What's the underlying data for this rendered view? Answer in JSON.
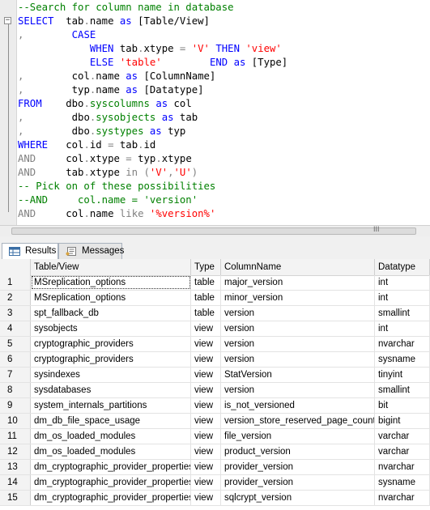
{
  "editor": {
    "lines": [
      [
        {
          "t": "--Search for column name in database",
          "c": "cm"
        }
      ],
      [
        {
          "t": "SELECT",
          "c": "kw"
        },
        {
          "t": "  tab",
          "c": "tx"
        },
        {
          "t": ".",
          "c": "gr"
        },
        {
          "t": "name ",
          "c": "tx"
        },
        {
          "t": "as",
          "c": "kw"
        },
        {
          "t": " [Table/View]",
          "c": "tx"
        }
      ],
      [
        {
          "t": ",",
          "c": "gr"
        },
        {
          "t": "        ",
          "c": "tx"
        },
        {
          "t": "CASE",
          "c": "kw"
        }
      ],
      [
        {
          "t": "            ",
          "c": "tx"
        },
        {
          "t": "WHEN",
          "c": "kw"
        },
        {
          "t": " tab",
          "c": "tx"
        },
        {
          "t": ".",
          "c": "gr"
        },
        {
          "t": "xtype ",
          "c": "tx"
        },
        {
          "t": "=",
          "c": "gr"
        },
        {
          "t": " ",
          "c": "tx"
        },
        {
          "t": "'V'",
          "c": "st"
        },
        {
          "t": " ",
          "c": "tx"
        },
        {
          "t": "THEN",
          "c": "kw"
        },
        {
          "t": " ",
          "c": "tx"
        },
        {
          "t": "'view'",
          "c": "st"
        }
      ],
      [
        {
          "t": "            ",
          "c": "tx"
        },
        {
          "t": "ELSE",
          "c": "kw"
        },
        {
          "t": " ",
          "c": "tx"
        },
        {
          "t": "'table'",
          "c": "st"
        },
        {
          "t": "        ",
          "c": "tx"
        },
        {
          "t": "END",
          "c": "kw"
        },
        {
          "t": " ",
          "c": "tx"
        },
        {
          "t": "as",
          "c": "kw"
        },
        {
          "t": " [Type]",
          "c": "tx"
        }
      ],
      [
        {
          "t": ",",
          "c": "gr"
        },
        {
          "t": "        col",
          "c": "tx"
        },
        {
          "t": ".",
          "c": "gr"
        },
        {
          "t": "name ",
          "c": "tx"
        },
        {
          "t": "as",
          "c": "kw"
        },
        {
          "t": " [ColumnName]",
          "c": "tx"
        }
      ],
      [
        {
          "t": ",",
          "c": "gr"
        },
        {
          "t": "        typ",
          "c": "tx"
        },
        {
          "t": ".",
          "c": "gr"
        },
        {
          "t": "name ",
          "c": "tx"
        },
        {
          "t": "as",
          "c": "kw"
        },
        {
          "t": " [Datatype]",
          "c": "tx"
        }
      ],
      [
        {
          "t": "FROM",
          "c": "kw"
        },
        {
          "t": "    dbo",
          "c": "tx"
        },
        {
          "t": ".",
          "c": "gr"
        },
        {
          "t": "syscolumns",
          "c": "sy"
        },
        {
          "t": " ",
          "c": "tx"
        },
        {
          "t": "as",
          "c": "kw"
        },
        {
          "t": " col",
          "c": "tx"
        }
      ],
      [
        {
          "t": ",",
          "c": "gr"
        },
        {
          "t": "        dbo",
          "c": "tx"
        },
        {
          "t": ".",
          "c": "gr"
        },
        {
          "t": "sysobjects",
          "c": "sy"
        },
        {
          "t": " ",
          "c": "tx"
        },
        {
          "t": "as",
          "c": "kw"
        },
        {
          "t": " tab",
          "c": "tx"
        }
      ],
      [
        {
          "t": ",",
          "c": "gr"
        },
        {
          "t": "        dbo",
          "c": "tx"
        },
        {
          "t": ".",
          "c": "gr"
        },
        {
          "t": "systypes",
          "c": "sy"
        },
        {
          "t": " ",
          "c": "tx"
        },
        {
          "t": "as",
          "c": "kw"
        },
        {
          "t": " typ",
          "c": "tx"
        }
      ],
      [
        {
          "t": "WHERE",
          "c": "kw"
        },
        {
          "t": "   col",
          "c": "tx"
        },
        {
          "t": ".",
          "c": "gr"
        },
        {
          "t": "id ",
          "c": "tx"
        },
        {
          "t": "=",
          "c": "gr"
        },
        {
          "t": " tab",
          "c": "tx"
        },
        {
          "t": ".",
          "c": "gr"
        },
        {
          "t": "id",
          "c": "tx"
        }
      ],
      [
        {
          "t": "AND",
          "c": "gr"
        },
        {
          "t": "     col",
          "c": "tx"
        },
        {
          "t": ".",
          "c": "gr"
        },
        {
          "t": "xtype ",
          "c": "tx"
        },
        {
          "t": "=",
          "c": "gr"
        },
        {
          "t": " typ",
          "c": "tx"
        },
        {
          "t": ".",
          "c": "gr"
        },
        {
          "t": "xtype",
          "c": "tx"
        }
      ],
      [
        {
          "t": "AND",
          "c": "gr"
        },
        {
          "t": "     tab",
          "c": "tx"
        },
        {
          "t": ".",
          "c": "gr"
        },
        {
          "t": "xtype ",
          "c": "tx"
        },
        {
          "t": "in",
          "c": "gr"
        },
        {
          "t": " ",
          "c": "tx"
        },
        {
          "t": "(",
          "c": "gr"
        },
        {
          "t": "'V'",
          "c": "st"
        },
        {
          "t": ",",
          "c": "gr"
        },
        {
          "t": "'U'",
          "c": "st"
        },
        {
          "t": ")",
          "c": "gr"
        }
      ],
      [
        {
          "t": "-- Pick on of these possibilities",
          "c": "cm"
        }
      ],
      [
        {
          "t": "--AND     col.name = 'version'",
          "c": "cm"
        }
      ],
      [
        {
          "t": "AND",
          "c": "gr"
        },
        {
          "t": "     col",
          "c": "tx"
        },
        {
          "t": ".",
          "c": "gr"
        },
        {
          "t": "name ",
          "c": "tx"
        },
        {
          "t": "like",
          "c": "gr"
        },
        {
          "t": " ",
          "c": "tx"
        },
        {
          "t": "'%version%'",
          "c": "st"
        }
      ]
    ],
    "scroll_grip": "III"
  },
  "tabs": {
    "results": "Results",
    "messages": "Messages"
  },
  "grid": {
    "columns": [
      "Table/View",
      "Type",
      "ColumnName",
      "Datatype"
    ],
    "rows": [
      [
        "1",
        "MSreplication_options",
        "table",
        "major_version",
        "int"
      ],
      [
        "2",
        "MSreplication_options",
        "table",
        "minor_version",
        "int"
      ],
      [
        "3",
        "spt_fallback_db",
        "table",
        "version",
        "smallint"
      ],
      [
        "4",
        "sysobjects",
        "view",
        "version",
        "int"
      ],
      [
        "5",
        "cryptographic_providers",
        "view",
        "version",
        "nvarchar"
      ],
      [
        "6",
        "cryptographic_providers",
        "view",
        "version",
        "sysname"
      ],
      [
        "7",
        "sysindexes",
        "view",
        "StatVersion",
        "tinyint"
      ],
      [
        "8",
        "sysdatabases",
        "view",
        "version",
        "smallint"
      ],
      [
        "9",
        "system_internals_partitions",
        "view",
        "is_not_versioned",
        "bit"
      ],
      [
        "10",
        "dm_db_file_space_usage",
        "view",
        "version_store_reserved_page_count",
        "bigint"
      ],
      [
        "11",
        "dm_os_loaded_modules",
        "view",
        "file_version",
        "varchar"
      ],
      [
        "12",
        "dm_os_loaded_modules",
        "view",
        "product_version",
        "varchar"
      ],
      [
        "13",
        "dm_cryptographic_provider_properties",
        "view",
        "provider_version",
        "nvarchar"
      ],
      [
        "14",
        "dm_cryptographic_provider_properties",
        "view",
        "provider_version",
        "sysname"
      ],
      [
        "15",
        "dm_cryptographic_provider_properties",
        "view",
        "sqlcrypt_version",
        "nvarchar"
      ]
    ]
  }
}
